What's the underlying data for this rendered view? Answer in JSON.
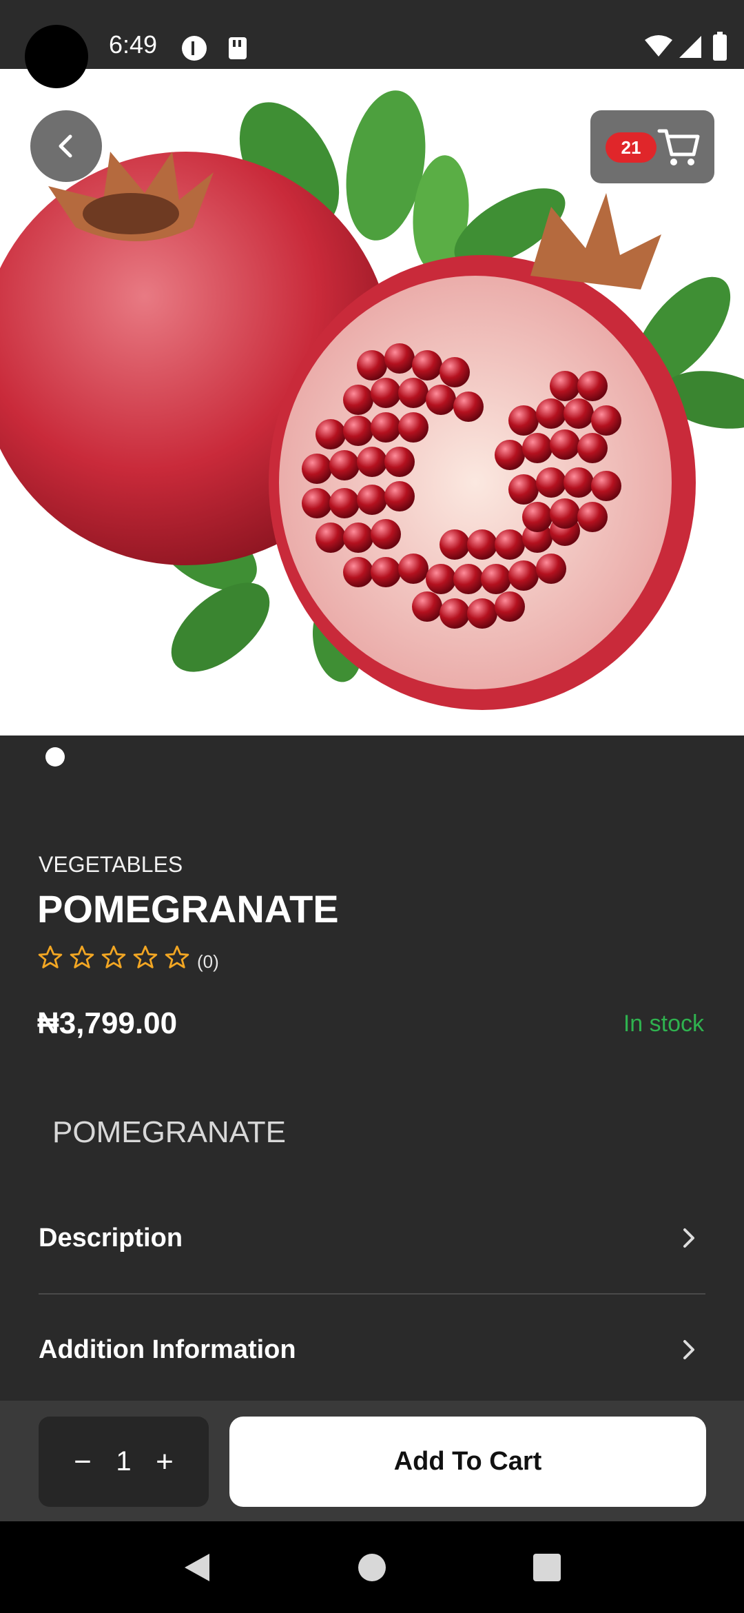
{
  "status": {
    "time": "6:49"
  },
  "product": {
    "category": "VEGETABLES",
    "title": "POMEGRANATE",
    "rating_count": "(0)",
    "price": "₦3,799.00",
    "stock": "In stock",
    "subtitle": "POMEGRANATE",
    "stars": 0
  },
  "header": {
    "cart_count": "21"
  },
  "sections": {
    "description_label": "Description",
    "additional_info_label": "Addition Information"
  },
  "cart_controls": {
    "quantity": "1",
    "minus": "−",
    "plus": "+",
    "add_to_cart": "Add To Cart"
  },
  "colors": {
    "accent_stock": "#2fb24f",
    "badge": "#e0262a",
    "star": "#f2a623"
  },
  "icons": {
    "back": "chevron-left-icon",
    "cart": "cart-icon",
    "chevron": "chevron-right-icon"
  }
}
